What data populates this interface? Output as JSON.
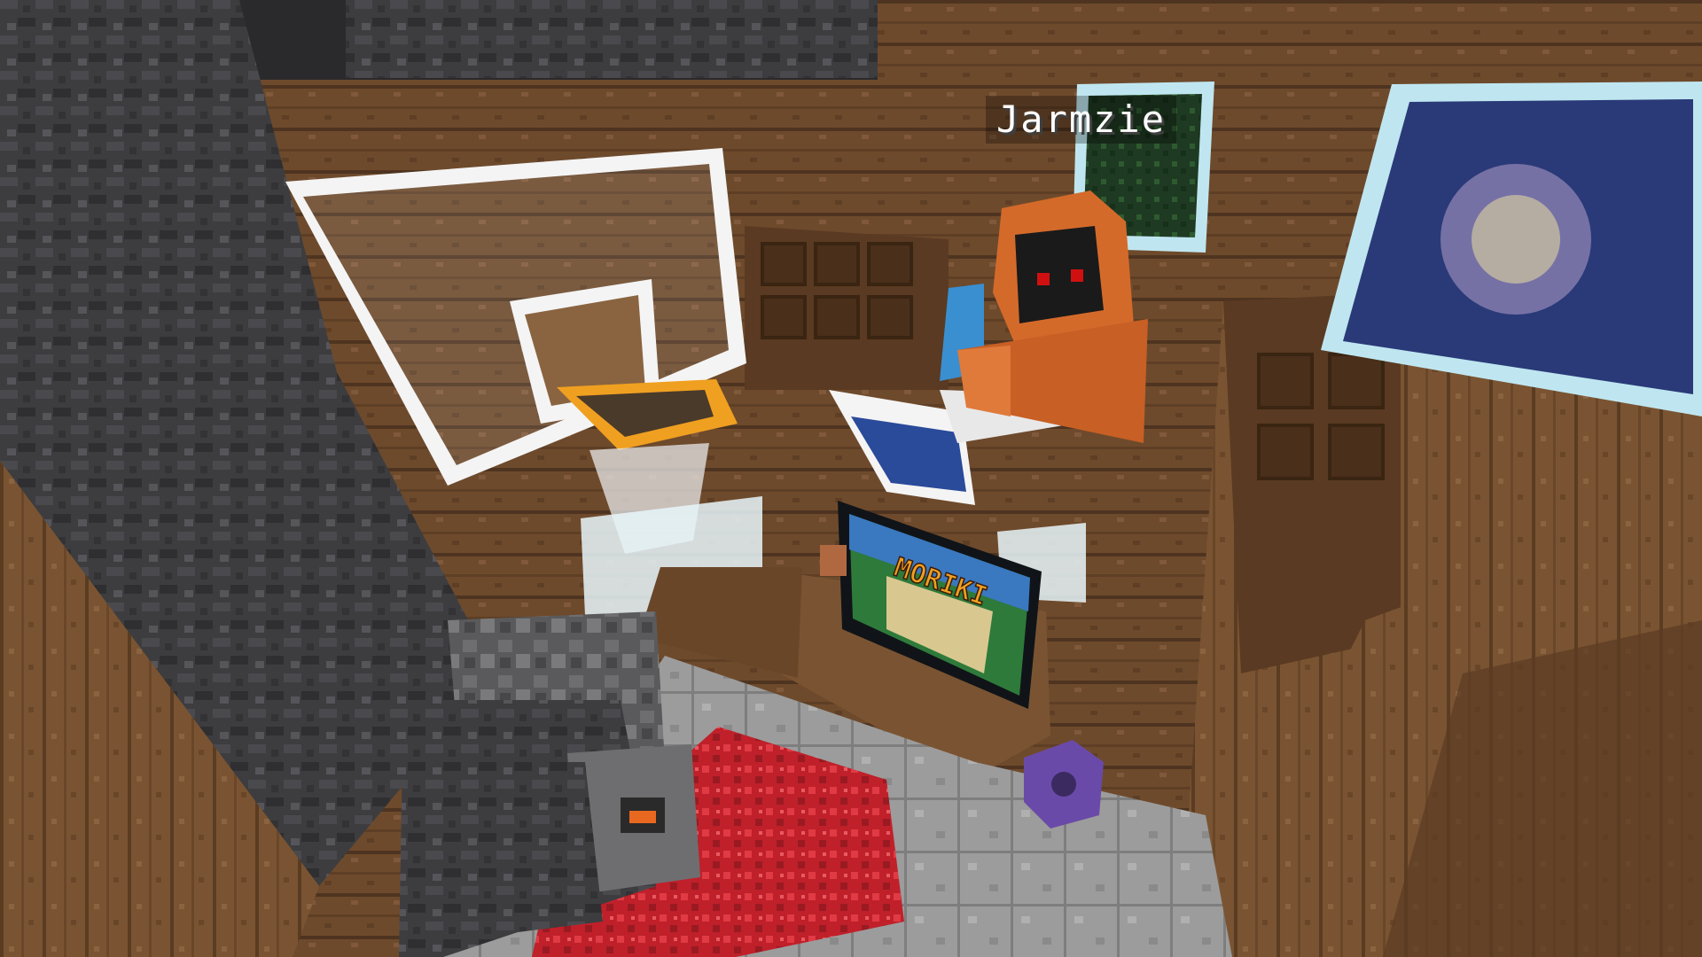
{
  "hud": {
    "player_nametag": "Jarmzie"
  },
  "scene": {
    "tv_screen_text": "MORIKI"
  },
  "colors": {
    "wood_plank": "#7a5432",
    "wood_dark": "#4e3420",
    "deepslate": "#3d3d40",
    "stone_floor": "#9c9c9c",
    "red_carpet": "#c0202a",
    "hood_orange": "#d46a2a",
    "hoop_orange": "#f0a020",
    "glass": "#bfe6f0"
  }
}
